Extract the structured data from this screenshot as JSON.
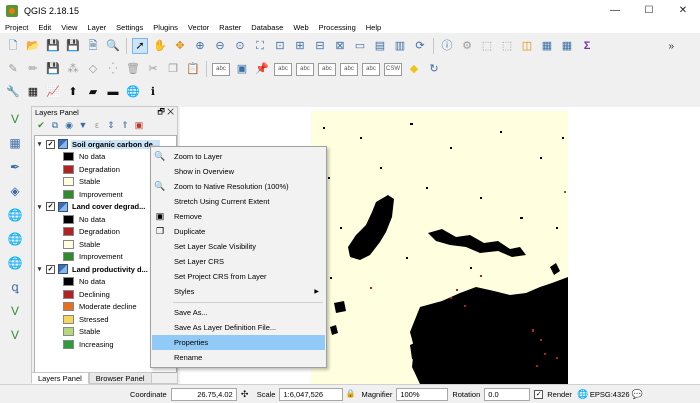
{
  "window": {
    "title": "QGIS 2.18.15",
    "minimize": "—",
    "maximize": "☐",
    "close": "✕"
  },
  "menubar": [
    "Project",
    "Edit",
    "View",
    "Layer",
    "Settings",
    "Plugins",
    "Vector",
    "Raster",
    "Database",
    "Web",
    "Processing",
    "Help"
  ],
  "layers_panel": {
    "title": "Layers Panel",
    "float_icon": "🗗",
    "close_icon": "✕",
    "layers": [
      {
        "name": "Soil organic carbon de...",
        "checked": true,
        "selected": true,
        "classes": [
          {
            "label": "No data",
            "color": "#000000"
          },
          {
            "label": "Degradation",
            "color": "#b22222"
          },
          {
            "label": "Stable",
            "color": "#ffffe0"
          },
          {
            "label": "Improvement",
            "color": "#2e8b2e"
          }
        ]
      },
      {
        "name": "Land cover degrad...",
        "checked": true,
        "selected": false,
        "classes": [
          {
            "label": "No data",
            "color": "#000000"
          },
          {
            "label": "Degradation",
            "color": "#b22222"
          },
          {
            "label": "Stable",
            "color": "#ffffe0"
          },
          {
            "label": "Improvement",
            "color": "#2e8b2e"
          }
        ]
      },
      {
        "name": "Land productivity d...",
        "checked": true,
        "selected": false,
        "classes": [
          {
            "label": "No data",
            "color": "#000000"
          },
          {
            "label": "Declining",
            "color": "#b22222"
          },
          {
            "label": "Moderate decline",
            "color": "#e8721c"
          },
          {
            "label": "Stressed",
            "color": "#f5d55a"
          },
          {
            "label": "Stable",
            "color": "#b6d77a"
          },
          {
            "label": "Increasing",
            "color": "#2e9c3a"
          }
        ]
      }
    ],
    "tabs": [
      "Layers Panel",
      "Browser Panel"
    ]
  },
  "context_menu": {
    "items": [
      {
        "label": "Zoom to Layer",
        "icon": "zoom-icon",
        "glyph": "🔍"
      },
      {
        "label": "Show in Overview",
        "icon": "",
        "glyph": ""
      },
      {
        "label": "Zoom to Native Resolution (100%)",
        "icon": "zoom-native-icon",
        "glyph": "🔍"
      },
      {
        "label": "Stretch Using Current Extent",
        "icon": "",
        "glyph": ""
      },
      {
        "label": "Remove",
        "icon": "remove-icon",
        "glyph": "▣"
      },
      {
        "label": "Duplicate",
        "icon": "duplicate-icon",
        "glyph": "❐"
      },
      {
        "label": "Set Layer Scale Visibility",
        "icon": "",
        "glyph": ""
      },
      {
        "label": "Set Layer CRS",
        "icon": "",
        "glyph": ""
      },
      {
        "label": "Set Project CRS from Layer",
        "icon": "",
        "glyph": ""
      },
      {
        "label": "Styles",
        "icon": "",
        "glyph": "",
        "submenu": true
      },
      {
        "separator": true
      },
      {
        "label": "Save As...",
        "icon": "",
        "glyph": ""
      },
      {
        "label": "Save As Layer Definition File...",
        "icon": "",
        "glyph": ""
      },
      {
        "label": "Properties",
        "icon": "",
        "glyph": "",
        "highlighted": true
      },
      {
        "label": "Rename",
        "icon": "",
        "glyph": ""
      }
    ],
    "submenu_arrow": "▶"
  },
  "statusbar": {
    "coordinate_label": "Coordinate",
    "coordinate_value": "26.75,4.02",
    "scale_label": "Scale",
    "scale_value": "1:6,047,526",
    "magnifier_label": "Magnifier",
    "magnifier_value": "100%",
    "rotation_label": "Rotation",
    "rotation_value": "0.0",
    "render_label": "Render",
    "render_checked": true,
    "crs": "EPSG:4326"
  },
  "colors": {
    "map_background": "#ffffe0",
    "degradation": "#b22222",
    "no_data": "#000000",
    "improvement": "#2e8b2e"
  }
}
